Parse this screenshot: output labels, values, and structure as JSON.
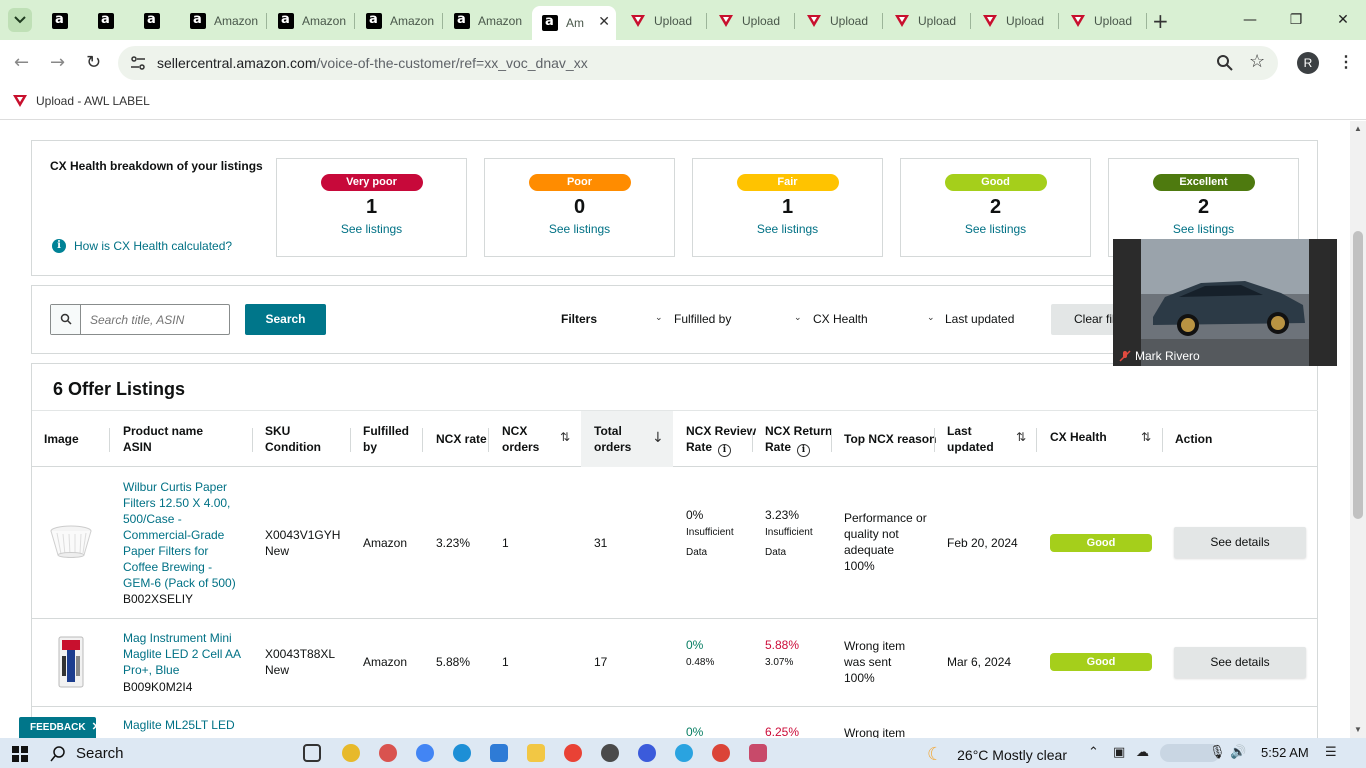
{
  "browser": {
    "tabs": [
      {
        "title": "",
        "icon": "amazon-icon"
      },
      {
        "title": "",
        "icon": "amazon-icon"
      },
      {
        "title": "",
        "icon": "amazon-icon"
      },
      {
        "title": "Amazon",
        "icon": "amazon-icon"
      },
      {
        "title": "Amazon",
        "icon": "amazon-icon"
      },
      {
        "title": "Amazon",
        "icon": "amazon-icon"
      },
      {
        "title": "Amazon",
        "icon": "amazon-icon"
      },
      {
        "title": "Am",
        "icon": "amazon-icon",
        "active": true
      },
      {
        "title": "Upload",
        "icon": "upload-icon"
      },
      {
        "title": "Upload",
        "icon": "upload-icon"
      },
      {
        "title": "Upload",
        "icon": "upload-icon"
      },
      {
        "title": "Upload",
        "icon": "upload-icon"
      },
      {
        "title": "Upload",
        "icon": "upload-icon"
      },
      {
        "title": "Upload",
        "icon": "upload-icon"
      }
    ],
    "url_host": "sellercentral.amazon.com",
    "url_path": "/voice-of-the-customer/ref=xx_voc_dnav_xx",
    "profile_initial": "R",
    "bookmark": "Upload - AWL LABEL"
  },
  "health": {
    "title": "CX Health breakdown of your listings",
    "help_link": "How is CX Health calculated?",
    "cards": [
      {
        "label": "Very poor",
        "count": "1",
        "link": "See listings",
        "color": "#c7093a",
        "text_color": "#ffffff"
      },
      {
        "label": "Poor",
        "count": "0",
        "link": "See listings",
        "color": "#ff8c00",
        "text_color": "#ffffff"
      },
      {
        "label": "Fair",
        "count": "1",
        "link": "See listings",
        "color": "#ffc300",
        "text_color": "#ffffff"
      },
      {
        "label": "Good",
        "count": "2",
        "link": "See listings",
        "color": "#a5cf1b",
        "text_color": "#ffffff"
      },
      {
        "label": "Excellent",
        "count": "2",
        "link": "See listings",
        "color": "#4e7a0f",
        "text_color": "#ffffff"
      }
    ]
  },
  "filters": {
    "search_placeholder": "Search title, ASIN",
    "search_button": "Search",
    "filters_label": "Filters",
    "fulfilled_by": "Fulfilled by",
    "cx_health": "CX Health",
    "last_updated": "Last updated",
    "clear": "Clear filters"
  },
  "listings": {
    "title": "6 Offer Listings",
    "columns": {
      "image": "Image",
      "product_1": "Product name",
      "product_2": "ASIN",
      "sku_1": "SKU",
      "sku_2": "Condition",
      "fulfilled_1": "Fulfilled",
      "fulfilled_2": "by",
      "ncx_rate": "NCX rate",
      "ncx_orders_1": "NCX",
      "ncx_orders_2": "orders",
      "total_orders_1": "Total",
      "total_orders_2": "orders",
      "review_1": "NCX Review",
      "review_2": "Rate",
      "return_1": "NCX Return",
      "return_2": "Rate",
      "top_reason": "Top NCX reason",
      "last_updated_1": "Last",
      "last_updated_2": "updated",
      "cx_health": "CX Health",
      "action": "Action"
    },
    "rows": [
      {
        "name": "Wilbur Curtis Paper Filters 12.50 X 4.00, 500/Case - Commercial-Grade Paper Filters for Coffee Brewing - GEM-6 (Pack of 500)",
        "asin": "B002XSELIY",
        "sku": "X0043V1GYH",
        "condition": "New",
        "fulfilled": "Amazon",
        "ncx_rate": "3.23%",
        "ncx_orders": "1",
        "total_orders": "31",
        "review_rate": "0%",
        "review_sub": "Insufficient Data",
        "return_rate": "3.23%",
        "return_sub": "Insufficient Data",
        "reason": "Performance or quality not adequate",
        "reason_pct": "100%",
        "last_updated": "Feb 20, 2024",
        "health": "Good",
        "action": "See details"
      },
      {
        "name": "Mag Instrument Mini Maglite LED 2 Cell AA Pro+, Blue",
        "asin": "B009K0M2I4",
        "sku": "X0043T88XL",
        "condition": "New",
        "fulfilled": "Amazon",
        "ncx_rate": "5.88%",
        "ncx_orders": "1",
        "total_orders": "17",
        "review_rate": "0%",
        "review_sub": "0.48%",
        "return_rate": "5.88%",
        "return_sub": "3.07%",
        "reason": "Wrong item was sent",
        "reason_pct": "100%",
        "last_updated": "Mar 6, 2024",
        "health": "Good",
        "action": "See details"
      },
      {
        "name": "Maglite ML25LT LED",
        "review_rate": "0%",
        "return_rate": "6.25%",
        "reason": "Wrong item"
      }
    ]
  },
  "feedback": "FEEDBACK",
  "video": {
    "name": "Mark Rivero"
  },
  "taskbar": {
    "search": "Search",
    "weather": "26°C  Mostly clear",
    "time": "5:52 AM"
  }
}
